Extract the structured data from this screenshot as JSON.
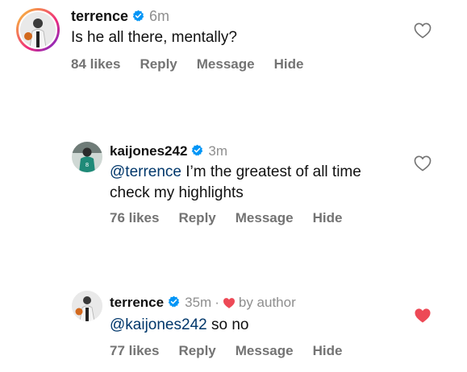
{
  "colors": {
    "text": "#111111",
    "secondary": "#8e8e8e",
    "mention": "#00376b",
    "verified": "#0095f6",
    "liked_heart": "#ed4956"
  },
  "comments": [
    {
      "username": "terrence",
      "verified": true,
      "time": "6m",
      "text": "Is he all there, mentally?",
      "likes": "84 likes",
      "reply": "Reply",
      "message": "Message",
      "hide": "Hide",
      "liked": false,
      "avatar_icon": "profile-photo-icon"
    },
    {
      "username": "kaijones242",
      "verified": true,
      "time": "3m",
      "mention": "@terrence",
      "text_line1": "I’m the greatest of all time",
      "text_line2": "check my highlights",
      "likes": "76 likes",
      "reply": "Reply",
      "message": "Message",
      "hide": "Hide",
      "liked": false,
      "avatar_icon": "profile-photo-icon"
    },
    {
      "username": "terrence",
      "verified": true,
      "time": "35m",
      "separator": "·",
      "author_badge": "by author",
      "mention": "@kaijones242",
      "text": "so no",
      "likes": "77 likes",
      "reply": "Reply",
      "message": "Message",
      "hide": "Hide",
      "liked": true,
      "avatar_icon": "profile-photo-icon"
    }
  ]
}
